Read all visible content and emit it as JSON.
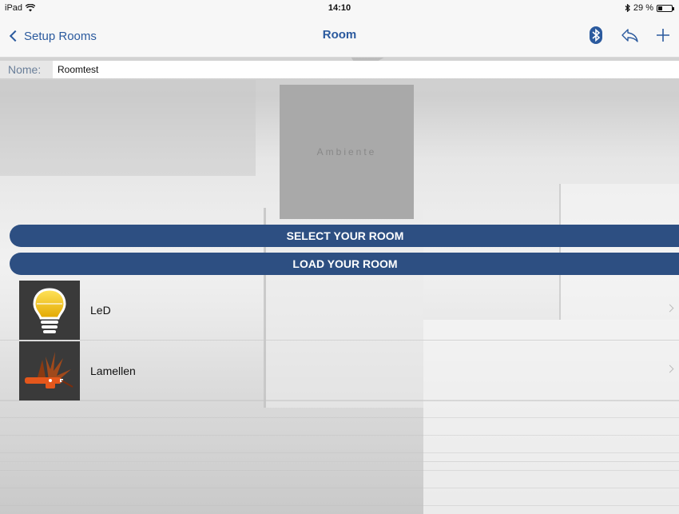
{
  "status_bar": {
    "device": "iPad",
    "time": "14:10",
    "battery_text": "29 %",
    "battery_level": 0.29
  },
  "nav": {
    "back_label": "Setup Rooms",
    "title": "Room",
    "icons": [
      "bluetooth-icon",
      "share-icon",
      "add-icon"
    ],
    "accent_color": "#2b5a9e"
  },
  "name_field": {
    "label": "Nome:",
    "value": "Roomtest"
  },
  "room_image": {
    "caption": "Ambiente"
  },
  "buttons": {
    "select_room": "SELECT YOUR ROOM",
    "load_room": "LOAD YOUR ROOM",
    "color": "#2d4f82"
  },
  "devices": [
    {
      "label": "LeD",
      "icon": "light-bulb-icon"
    },
    {
      "label": "Lamellen",
      "icon": "blinds-icon"
    }
  ]
}
